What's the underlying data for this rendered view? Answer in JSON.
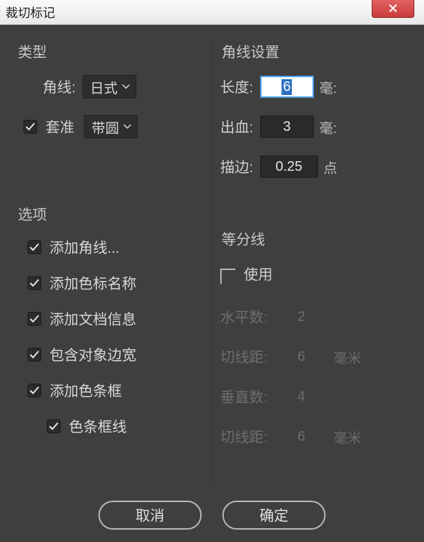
{
  "dialog": {
    "title": "裁切标记"
  },
  "type_group": {
    "title": "类型",
    "corner_label": "角线:",
    "corner_value": "日式",
    "reg_label": "套准",
    "reg_checked": true,
    "reg_value": "带圆"
  },
  "options_group": {
    "title": "选项",
    "items": [
      {
        "label": "添加角线...",
        "checked": true,
        "nested": false
      },
      {
        "label": "添加色标名称",
        "checked": true,
        "nested": false
      },
      {
        "label": "添加文档信息",
        "checked": true,
        "nested": false
      },
      {
        "label": "包含对象边宽",
        "checked": true,
        "nested": false
      },
      {
        "label": "添加色条框",
        "checked": true,
        "nested": false
      },
      {
        "label": "色条框线",
        "checked": true,
        "nested": true
      }
    ]
  },
  "corner_settings": {
    "title": "角线设置",
    "length_label": "长度:",
    "length_value": "6",
    "length_unit": "毫:",
    "bleed_label": "出血:",
    "bleed_value": "3",
    "bleed_unit": "毫:",
    "stroke_label": "描边:",
    "stroke_value": "0.25",
    "stroke_unit": "点"
  },
  "division": {
    "title": "等分线",
    "use_label": "使用",
    "use_checked": false,
    "hcount_label": "水平数:",
    "hcount_value": "2",
    "hcut_label": "切线距:",
    "hcut_value": "6",
    "hcut_unit": "毫米",
    "vcount_label": "垂直数:",
    "vcount_value": "4",
    "vcut_label": "切线距:",
    "vcut_value": "6",
    "vcut_unit": "毫米"
  },
  "buttons": {
    "cancel": "取消",
    "ok": "确定"
  }
}
